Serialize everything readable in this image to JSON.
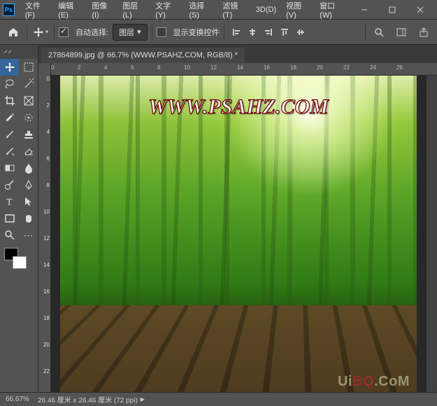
{
  "app": {
    "logo": "Ps"
  },
  "menu": {
    "file": "文件(F)",
    "edit": "编辑(E)",
    "image": "图像(I)",
    "layer": "图层(L)",
    "type": "文字(Y)",
    "select": "选择(S)",
    "filter": "滤镜(T)",
    "threed": "3D(D)",
    "view": "视图(V)",
    "window": "窗口(W)"
  },
  "options": {
    "auto_select_label": "自动选择:",
    "auto_select_dropdown": "图层",
    "show_transform_label": "显示变换控件"
  },
  "document": {
    "tab_title": "27864899.jpg @ 66.7% (WWW.PSAHZ.COM, RGB/8) *",
    "watermark_main": "WWW.PSAHZ.COM",
    "watermark_corner_pre": "Ui",
    "watermark_corner_bq": "BQ",
    "watermark_corner_post": ".CoM"
  },
  "ruler": {
    "h": [
      "0",
      "2",
      "4",
      "6",
      "8",
      "10",
      "12",
      "14",
      "16",
      "18",
      "20",
      "22",
      "24",
      "26"
    ],
    "v": [
      "0",
      "2",
      "4",
      "6",
      "8",
      "10",
      "12",
      "14",
      "16",
      "18",
      "20",
      "22"
    ]
  },
  "status": {
    "zoom": "66.67%",
    "dimensions": "26.46 厘米 x 26.46 厘米 (72 ppi)"
  },
  "icons": {
    "home": "⌂",
    "chevron": "▾",
    "search": "⌕",
    "more": "⋯"
  }
}
